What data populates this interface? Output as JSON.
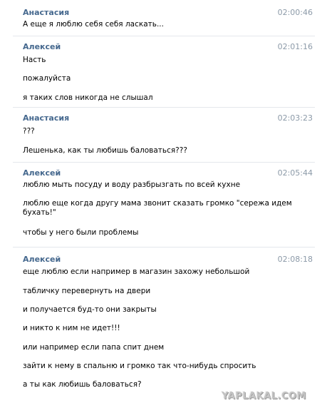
{
  "messages": [
    {
      "author": "Анастасия",
      "time": "02:00:46",
      "lines": [
        "А еще я люблю себя себя ласкать..."
      ]
    },
    {
      "author": "Алексей",
      "time": "02:01:16",
      "lines": [
        "Насть",
        "пожалуйста",
        "я таких слов никогда не слышал"
      ]
    },
    {
      "author": "Анастасия",
      "time": "02:03:23",
      "lines": [
        "???",
        "Лешенька, как ты любишь баловаться???"
      ]
    },
    {
      "author": "Алексей",
      "time": "02:05:44",
      "lines": [
        "люблю мыть посуду и воду разбрызгать по всей кухне",
        "люблю еще когда другу мама звонит сказать громко \"сережа идем",
        "бухать!\"",
        "чтобы у него были проблемы"
      ]
    },
    {
      "author": "Алексей",
      "time": "02:08:18",
      "lines": [
        "еще люблю если например в магазин захожу небольшой",
        "табличку перевернуть на двери",
        "и получается буд-то они закрыты",
        "и никто к ним не идет!!!",
        "или например если папа спит днем",
        "зайти к нему в спальню и громко так что-нибудь спросить",
        "а ты как любишь баловаться?"
      ]
    }
  ],
  "watermark": "YAPLAKAL.COM"
}
